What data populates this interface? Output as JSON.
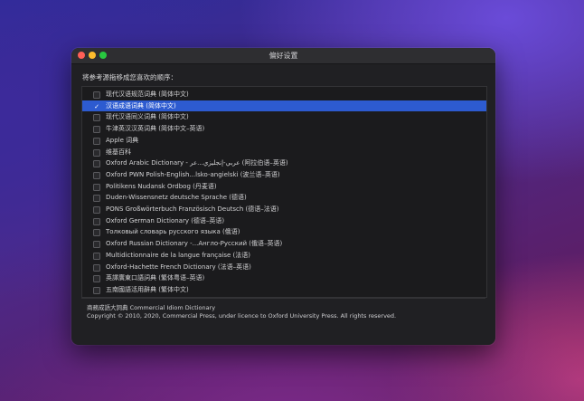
{
  "window": {
    "title": "偏好设置"
  },
  "instruction": "将参考源拖移成您喜欢的顺序：",
  "dictionaries": [
    {
      "label": "现代汉语规范词典 (简体中文)",
      "checked": false
    },
    {
      "label": "汉语成语词典 (简体中文)",
      "checked": true,
      "selected": true
    },
    {
      "label": "现代汉语同义词典 (简体中文)",
      "checked": false
    },
    {
      "label": "牛津英汉汉英词典 (简体中文–英语)",
      "checked": false
    },
    {
      "label": "Apple 词典",
      "checked": false
    },
    {
      "label": "维基百科",
      "checked": false
    },
    {
      "label": "Oxford Arabic Dictionary - عربي-إنجليزي...عر (阿拉伯语–英语)",
      "checked": false
    },
    {
      "label": "Oxford PWN Polish-English...lsko-angielski (波兰语–英语)",
      "checked": false
    },
    {
      "label": "Politikens Nudansk Ordbog (丹麦语)",
      "checked": false
    },
    {
      "label": "Duden-Wissensnetz deutsche Sprache (德语)",
      "checked": false
    },
    {
      "label": "PONS Großwörterbuch Französisch Deutsch (德语–法语)",
      "checked": false
    },
    {
      "label": "Oxford German Dictionary (德语–英语)",
      "checked": false
    },
    {
      "label": "Толковый словарь русского языка (俄语)",
      "checked": false
    },
    {
      "label": "Oxford Russian Dictionary -...Англо-Русский (俄语–英语)",
      "checked": false
    },
    {
      "label": "Multidictionnaire de la langue française (法语)",
      "checked": false
    },
    {
      "label": "Oxford-Hachette French Dictionary (法语–英语)",
      "checked": false
    },
    {
      "label": "英譯廣東口語詞典 (繁体粤语–英语)",
      "checked": false
    },
    {
      "label": "五南國語活用辭典 (繁体中文)",
      "checked": false
    }
  ],
  "info": {
    "line1": "商務成語大詞典 Commercial Idiom Dictionary",
    "line2": "Copyright © 2010, 2020, Commercial Press, under licence to Oxford University Press. All rights reserved."
  },
  "colors": {
    "accent": "#2d5bd0",
    "window_bg": "#202023"
  },
  "icons": {
    "check": "checkmark-icon"
  }
}
